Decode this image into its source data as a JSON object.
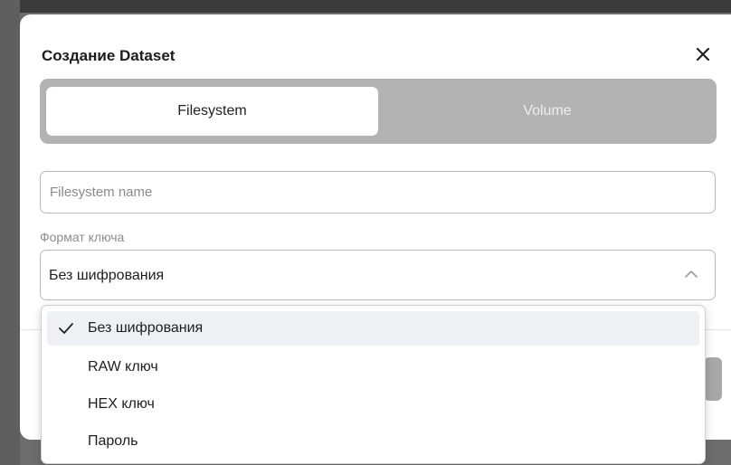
{
  "modal": {
    "title": "Создание Dataset",
    "close_icon": "close-icon"
  },
  "tabs": [
    {
      "label": "Filesystem",
      "active": true
    },
    {
      "label": "Volume",
      "active": false
    }
  ],
  "name_field": {
    "value": "",
    "placeholder": "Filesystem name"
  },
  "key_format": {
    "label": "Формат ключа",
    "selected": "Без шифрования",
    "chevron_icon": "chevron-up-icon",
    "expanded": true,
    "options": [
      {
        "label": "Без шифрования",
        "selected": true
      },
      {
        "label": "RAW ключ",
        "selected": false
      },
      {
        "label": "HEX ключ",
        "selected": false
      },
      {
        "label": "Пароль",
        "selected": false
      }
    ],
    "check_icon": "check-icon"
  },
  "colors": {
    "backdrop": "#6d6d6d",
    "segment_track": "#b3b3b3",
    "selected_option_bg": "#eef0f4"
  }
}
